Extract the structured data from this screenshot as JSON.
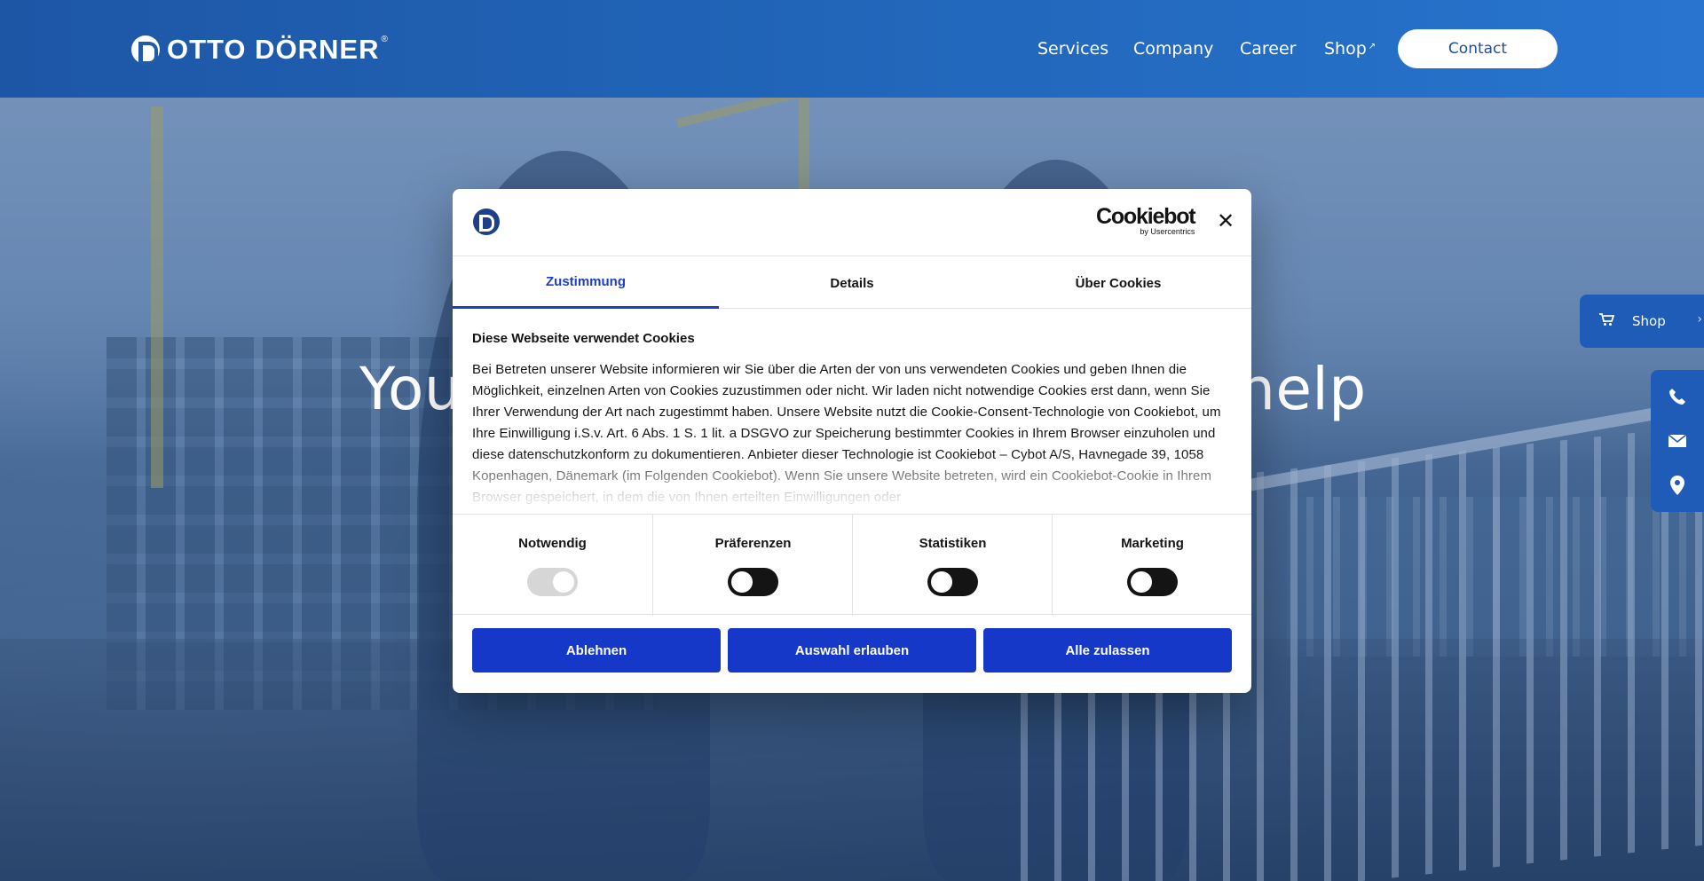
{
  "header": {
    "logo_text": "OTTO DÖRNER",
    "logo_reg": "®",
    "nav": [
      {
        "label": "Services"
      },
      {
        "label": "Company"
      },
      {
        "label": "Career"
      },
      {
        "label": "Shop",
        "external_icon": "↗"
      }
    ],
    "contact_label": "Contact"
  },
  "hero": {
    "headline_left": "You",
    "headline_right": "help"
  },
  "side": {
    "shop_label": "Shop",
    "shop_icon": "cart-icon",
    "contact_icons": [
      "phone-icon",
      "mail-icon",
      "location-icon"
    ]
  },
  "cookie_dialog": {
    "brand": "Cookiebot",
    "brand_sub": "by Usercentrics",
    "close": "✕",
    "tabs": [
      {
        "label": "Zustimmung",
        "active": true
      },
      {
        "label": "Details",
        "active": false
      },
      {
        "label": "Über Cookies",
        "active": false
      }
    ],
    "title": "Diese Webseite verwendet Cookies",
    "text": "Bei Betreten unserer Website informieren wir Sie über die Arten der von uns verwendeten Cookies und geben Ihnen die Möglichkeit, einzelnen Arten von Cookies zuzustimmen oder nicht. Wir laden nicht notwendige Cookies erst dann, wenn Sie Ihrer Verwendung der Art nach zugestimmt haben. Unsere Website nutzt die Cookie-Consent-Technologie von Cookiebot, um Ihre Einwilligung i.S.v. Art. 6 Abs. 1 S. 1 lit. a DSGVO zur Speicherung bestimmter Cookies in Ihrem Browser einzuholen und diese datenschutzkonform zu dokumentieren. Anbieter dieser Technologie ist Cookiebot – Cybot A/S, Havnegade 39, 1058 Kopenhagen, Dänemark (im Folgenden Cookiebot). Wenn Sie unsere Website betreten, wird ein Cookiebot-Cookie in Ihrem Browser gespeichert, in dem die von Ihnen erteilten Einwilligungen oder",
    "categories": [
      {
        "label": "Notwendig",
        "enabled": true,
        "disabled": true
      },
      {
        "label": "Präferenzen",
        "enabled": false,
        "disabled": false
      },
      {
        "label": "Statistiken",
        "enabled": false,
        "disabled": false
      },
      {
        "label": "Marketing",
        "enabled": false,
        "disabled": false
      }
    ],
    "buttons": {
      "decline": "Ablehnen",
      "allow_selection": "Auswahl erlauben",
      "allow_all": "Alle zulassen"
    },
    "colors": {
      "accent": "#1638c9",
      "tab_active": "#1e3ec8"
    }
  },
  "colors": {
    "header_blue": "#2166b9",
    "side_blue": "#1f5cb8"
  }
}
